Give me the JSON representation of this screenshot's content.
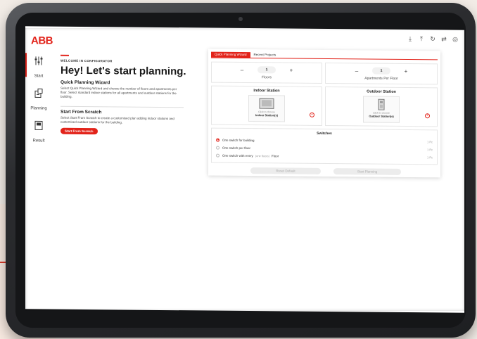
{
  "brand": {
    "logo": "ABB",
    "accent": "#e2231a"
  },
  "topbar": {
    "icons": [
      "download-icon",
      "upload-icon",
      "refresh-icon",
      "share-icon",
      "user-icon"
    ]
  },
  "sidebar": {
    "items": [
      {
        "label": "Start",
        "icon": "sliders-icon",
        "active": true
      },
      {
        "label": "Planning",
        "icon": "plan-icon",
        "active": false
      },
      {
        "label": "Result",
        "icon": "result-icon",
        "active": false
      }
    ]
  },
  "intro": {
    "welcome": "WELCOME IN CONFIGURATOR",
    "headline": "Hey! Let's start planning.",
    "quick_title": "Quick Planning Wizard",
    "quick_text": "Select Quick Planning Wizard and choose the number of floors and apartments per floor. Select standard indoor stations for all apartments and outdoor stations for the building.",
    "scratch_title": "Start From Scratch",
    "scratch_text": "Select Start From Scratch to create a customised plan adding indoor stations and customised outdoor stations for the building.",
    "scratch_button": "Start From Scratch"
  },
  "wizard": {
    "tabs": [
      "Quick Planning Wizard",
      "Recent Projects"
    ],
    "floors": {
      "value": "1",
      "label": "Floors",
      "minus": "–",
      "plus": "+"
    },
    "apartments": {
      "value": "1",
      "label": "Apartments Per Floor",
      "minus": "–",
      "plus": "+"
    },
    "indoor": {
      "title": "Indoor Station",
      "hint": "Click to choose",
      "name": "Indoor Station(s)"
    },
    "outdoor": {
      "title": "Outdoor Station",
      "hint": "Click to choose",
      "name": "Outdoor Station(s)"
    },
    "add_symbol": "+",
    "switches": {
      "title": "Switches",
      "options": [
        {
          "label": "One switch for building",
          "extra": "",
          "count": "1 Pc",
          "selected": true
        },
        {
          "label": "One switch per floor",
          "extra": "",
          "count": "1 Pc",
          "selected": false
        },
        {
          "label": "One switch with every",
          "extra": "(one floors)",
          "suffix": "Floor",
          "count": "1 Pc",
          "selected": false
        }
      ]
    },
    "reset_button": "Reset Default",
    "start_button": "Start Planning"
  }
}
